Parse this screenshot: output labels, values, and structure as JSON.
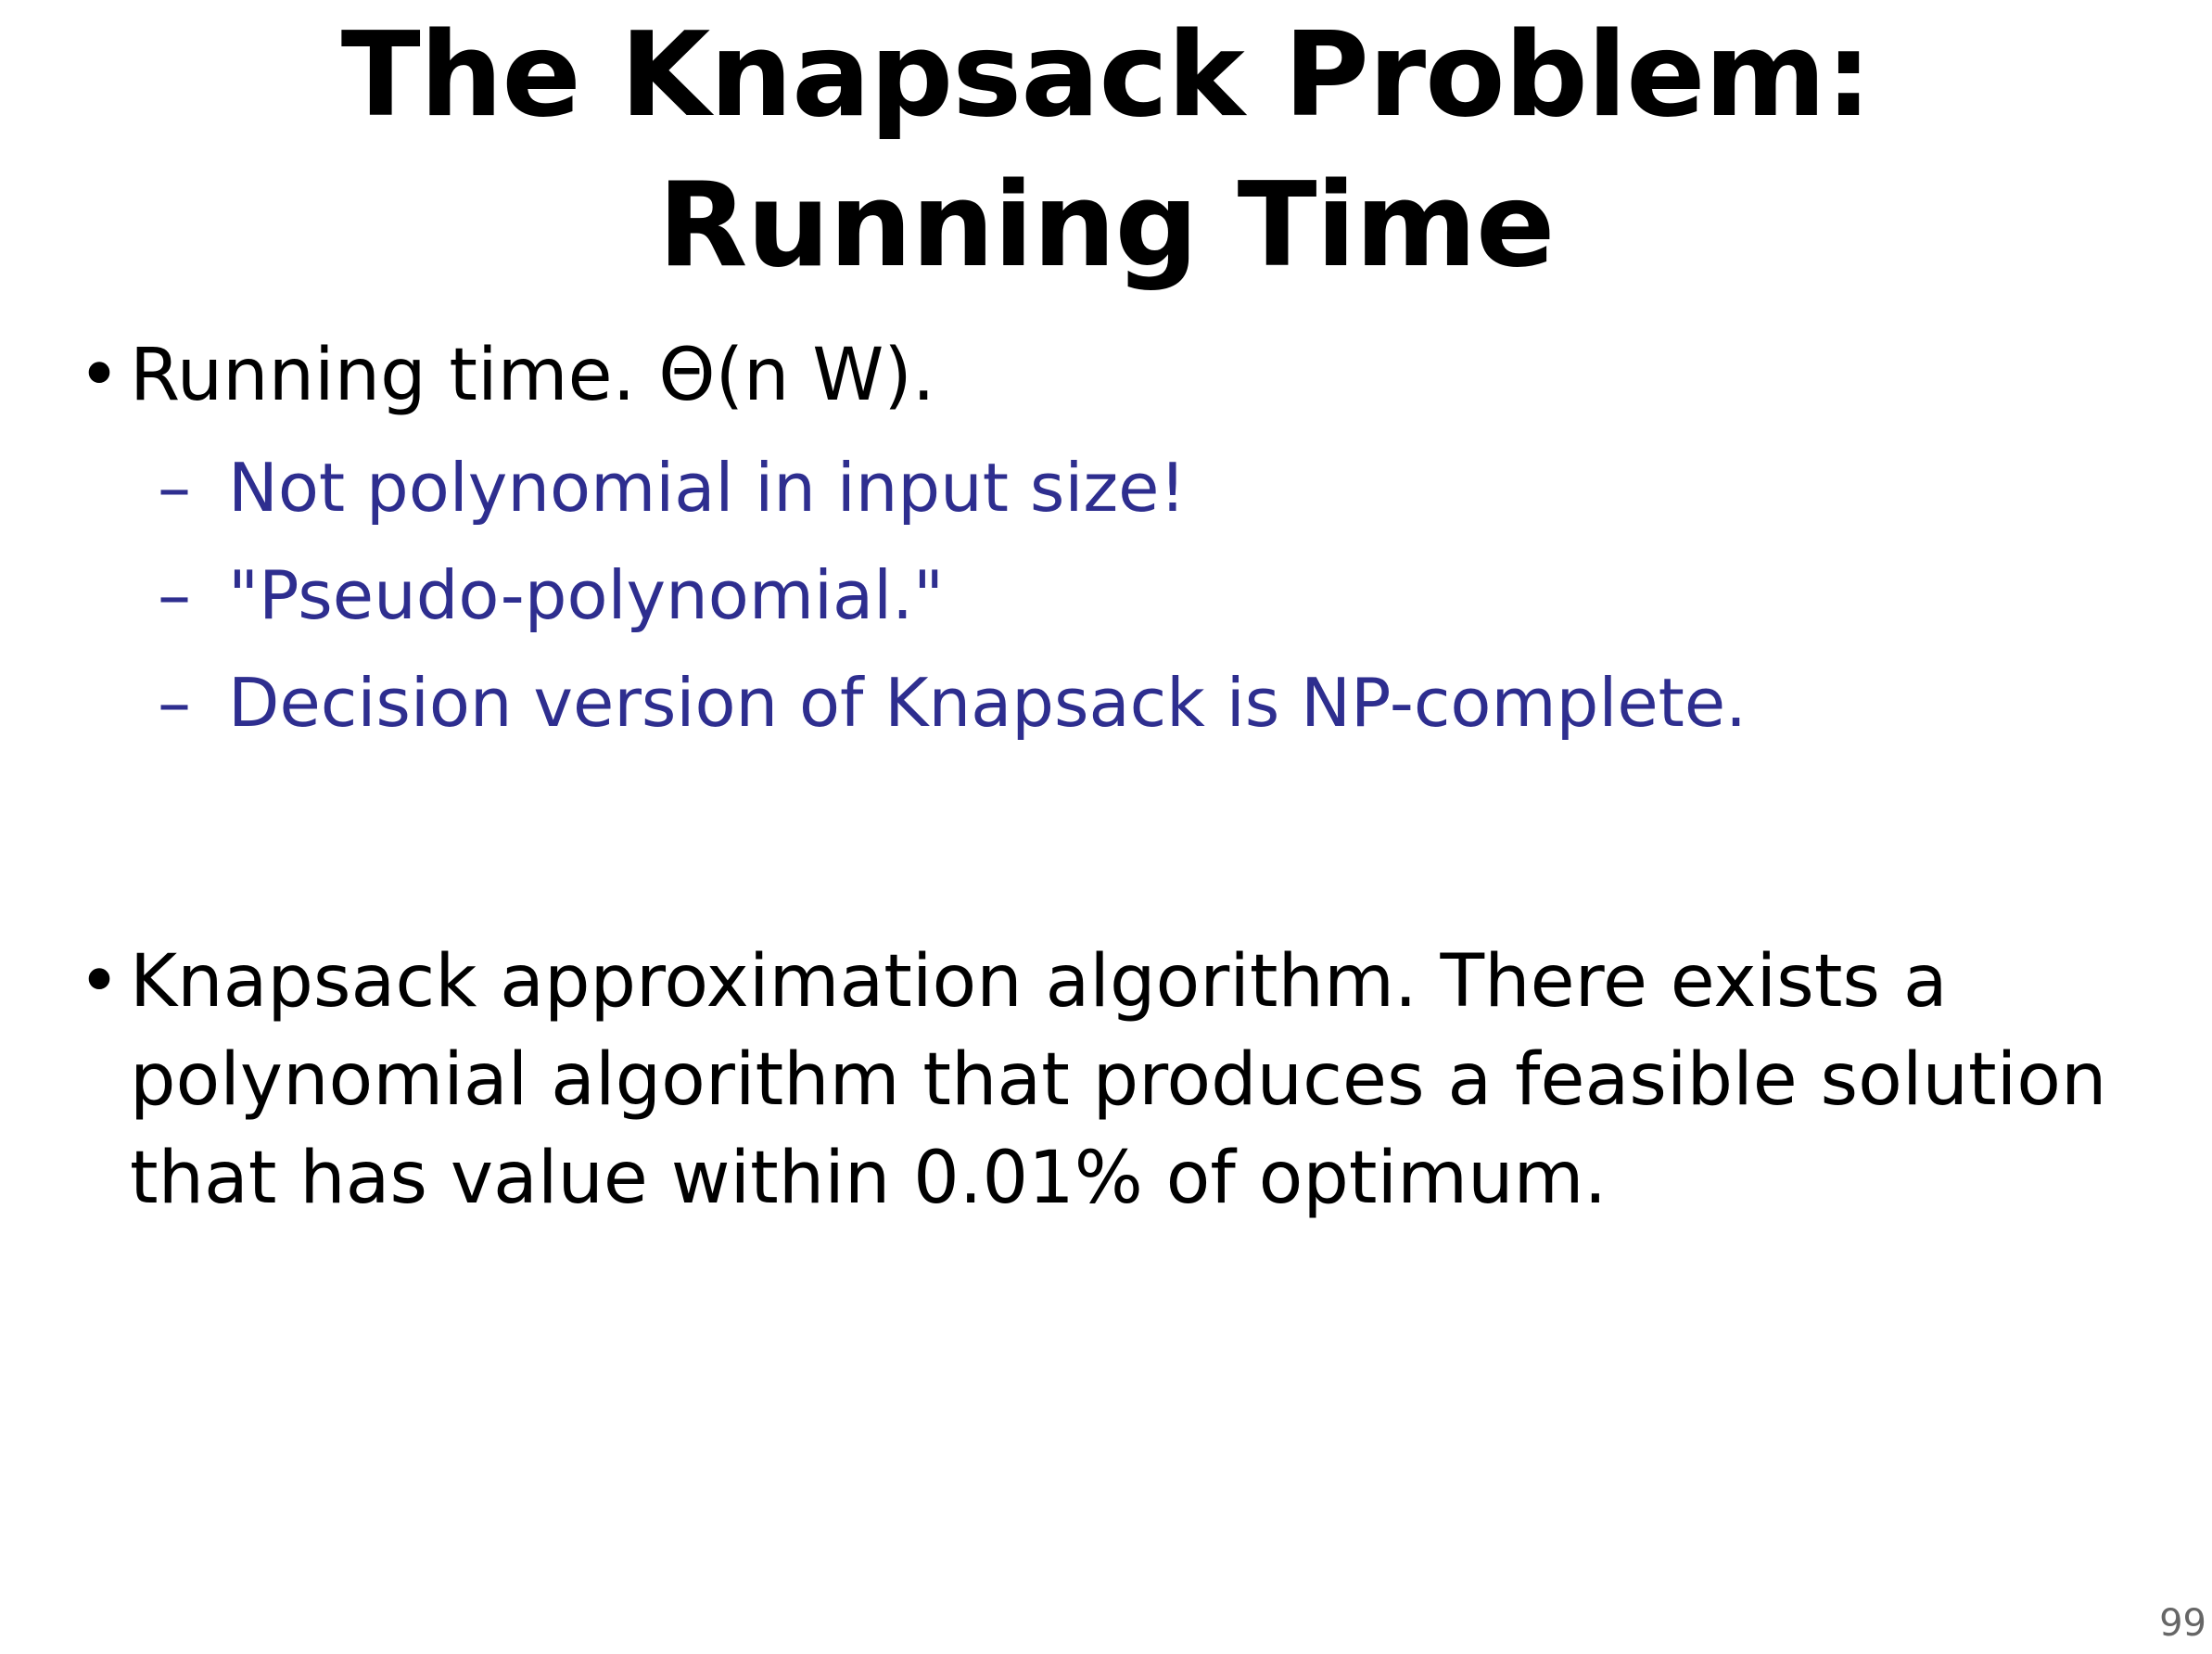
{
  "slide": {
    "title_lines": [
      "The Knapsack Problem:",
      "Running Time"
    ],
    "bullets": [
      {
        "marker": "•",
        "lines": [
          "Running time. Θ(n W)."
        ],
        "sub_items": [
          {
            "marker": "–",
            "text": "Not polynomial in input size!"
          },
          {
            "marker": "–",
            "text": "\"Pseudo-polynomial.\""
          },
          {
            "marker": "–",
            "text": "Decision version of Knapsack is NP-complete."
          }
        ]
      },
      {
        "marker": "•",
        "lines": [
          "Knapsack approximation algorithm. There exists a",
          "polynomial algorithm that produces a feasible solution",
          "that has value within 0.01% of optimum."
        ]
      }
    ],
    "page_number": "99",
    "colors": {
      "background": "#ffffff",
      "text": "#000000",
      "sub_item_text": "#2e2e8f",
      "page_number": "#666666"
    }
  }
}
